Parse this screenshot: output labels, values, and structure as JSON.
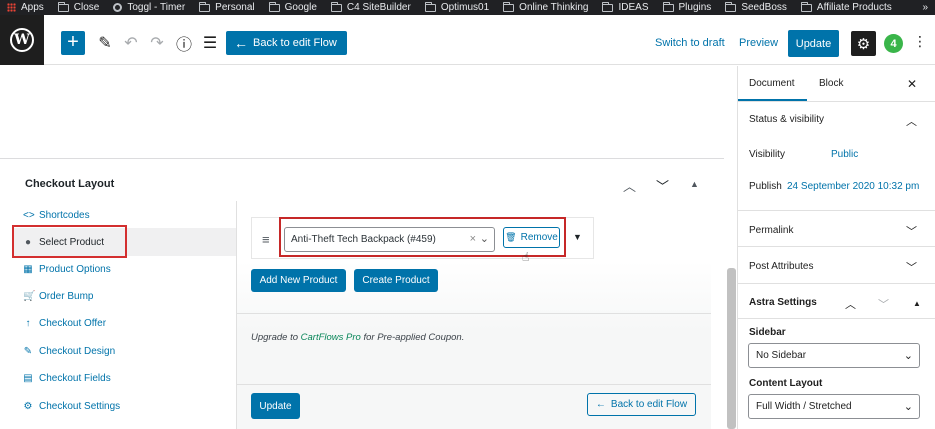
{
  "bookmarks": [
    {
      "label": "Apps",
      "icon": "apps-grid-icon"
    },
    {
      "label": "Close",
      "icon": "folder-icon"
    },
    {
      "label": "Toggl - Timer",
      "icon": "toggl-icon"
    },
    {
      "label": "Personal",
      "icon": "folder-icon"
    },
    {
      "label": "Google",
      "icon": "folder-icon"
    },
    {
      "label": "C4 SiteBuilder",
      "icon": "folder-icon"
    },
    {
      "label": "Optimus01",
      "icon": "folder-icon"
    },
    {
      "label": "Online Thinking",
      "icon": "folder-icon"
    },
    {
      "label": "IDEAS",
      "icon": "folder-icon"
    },
    {
      "label": "Plugins",
      "icon": "folder-icon"
    },
    {
      "label": "SeedBoss",
      "icon": "folder-icon"
    },
    {
      "label": "Affiliate Products",
      "icon": "folder-icon"
    }
  ],
  "bookmarks_more": "»",
  "toolbar": {
    "logo": "W",
    "add": "+",
    "back_to_flow": "Back to edit Flow",
    "switch_to_draft": "Switch to draft",
    "preview": "Preview",
    "update": "Update",
    "bolt": "4"
  },
  "metabox": {
    "title": "Checkout Layout",
    "tabs": [
      {
        "label": "Shortcodes",
        "icon": "code-icon",
        "glyph": "<>"
      },
      {
        "label": "Select Product",
        "icon": "info-icon",
        "glyph": "●"
      },
      {
        "label": "Product Options",
        "icon": "grid-icon",
        "glyph": "▦"
      },
      {
        "label": "Order Bump",
        "icon": "cart-icon",
        "glyph": "🛒"
      },
      {
        "label": "Checkout Offer",
        "icon": "arrow-up-icon",
        "glyph": "↑"
      },
      {
        "label": "Checkout Design",
        "icon": "brush-icon",
        "glyph": "✎"
      },
      {
        "label": "Checkout Fields",
        "icon": "table-icon",
        "glyph": "▤"
      },
      {
        "label": "Checkout Settings",
        "icon": "gear-icon",
        "glyph": "⚙"
      }
    ],
    "product": {
      "selected": "Anti-Theft Tech Backpack (#459)",
      "remove": "Remove"
    },
    "add_new_product": "Add New Product",
    "create_product": "Create Product",
    "upgrade_prefix": "Upgrade to ",
    "upgrade_link": "CartFlows Pro",
    "upgrade_suffix": " for Pre-applied Coupon.",
    "update": "Update",
    "back_to_flow": "Back to edit Flow"
  },
  "sidebar": {
    "tabs": [
      "Document",
      "Block"
    ],
    "status_visibility": "Status & visibility",
    "visibility_label": "Visibility",
    "visibility_value": "Public",
    "publish_label": "Publish",
    "publish_value": "24 September 2020 10:32 pm",
    "permalink": "Permalink",
    "post_attributes": "Post Attributes",
    "astra_settings": "Astra Settings",
    "sidebar_label": "Sidebar",
    "sidebar_value": "No Sidebar",
    "content_layout_label": "Content Layout",
    "content_layout_value": "Full Width / Stretched"
  },
  "colors": {
    "accent": "#0073aa",
    "highlight": "#d32f2f",
    "link_green": "#0a875a"
  }
}
